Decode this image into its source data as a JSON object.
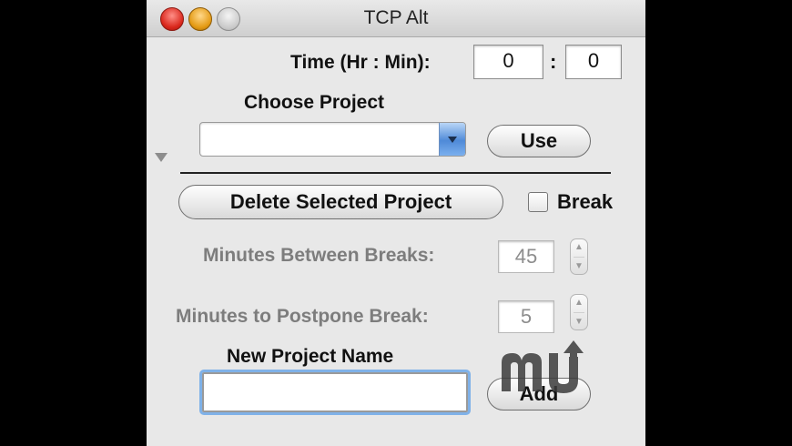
{
  "window": {
    "title": "TCP Alt"
  },
  "time": {
    "label": "Time (Hr : Min):",
    "hours": "0",
    "separator": ":",
    "minutes": "0"
  },
  "project": {
    "label": "Choose Project",
    "selected": "",
    "use_label": "Use"
  },
  "actions": {
    "delete_label": "Delete Selected Project",
    "break_label": "Break"
  },
  "breaks": {
    "between_label": "Minutes Between Breaks:",
    "between_value": "45",
    "postpone_label": "Minutes to Postpone Break:",
    "postpone_value": "5"
  },
  "new_project": {
    "label": "New Project Name",
    "value": "",
    "add_label": "Add"
  },
  "colors": {
    "focus_ring": "#7fb1e8",
    "popup_arrow": "#2f6ec8",
    "dim_text": "#7d7d7d"
  },
  "icons": {
    "disclosure": "disclosure-triangle-icon",
    "watermark": "macupdate-watermark"
  }
}
